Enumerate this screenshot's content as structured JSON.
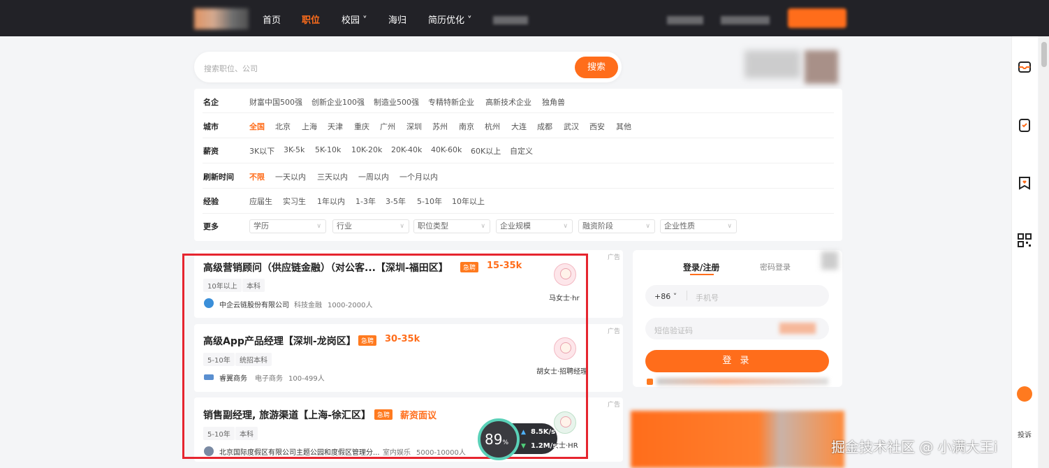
{
  "nav": {
    "items": [
      "首页",
      "职位",
      "校园 ˅",
      "海归",
      "简历优化 ˅"
    ],
    "active_index": 1
  },
  "search": {
    "placeholder": "搜索职位、公司",
    "button": "搜索"
  },
  "filters": {
    "famous": {
      "label": "名企",
      "options": [
        "财富中国500强",
        "创新企业100强",
        "制造业500强",
        "专精特新企业",
        "高新技术企业",
        "独角兽"
      ]
    },
    "city": {
      "label": "城市",
      "options": [
        "全国",
        "北京",
        "上海",
        "天津",
        "重庆",
        "广州",
        "深圳",
        "苏州",
        "南京",
        "杭州",
        "大连",
        "成都",
        "武汉",
        "西安",
        "其他"
      ],
      "selected": "全国"
    },
    "salary": {
      "label": "薪资",
      "options": [
        "3K以下",
        "3K-5k",
        "5K-10k",
        "10K-20k",
        "20K-40k",
        "40K-60k",
        "60K以上",
        "自定义"
      ]
    },
    "refresh": {
      "label": "刷新时间",
      "options": [
        "不限",
        "一天以内",
        "三天以内",
        "一周以内",
        "一个月以内"
      ],
      "selected": "不限"
    },
    "experience": {
      "label": "经验",
      "options": [
        "应届生",
        "实习生",
        "1年以内",
        "1-3年",
        "3-5年",
        "5-10年",
        "10年以上"
      ]
    },
    "more": {
      "label": "更多",
      "dropdowns": [
        "学历",
        "行业",
        "职位类型",
        "企业规模",
        "融资阶段",
        "企业性质"
      ]
    }
  },
  "jobs": [
    {
      "title": "高级营销顾问（供应链金融）（对公客...【深圳-福田区】",
      "urgent": "急聘",
      "salary": "15-35k",
      "tags": [
        "10年以上",
        "本科"
      ],
      "company": "中企云链股份有限公司",
      "industry": "科技金融",
      "size": "1000-2000人",
      "hr": "马女士·hr",
      "ad": "广告"
    },
    {
      "title": "高级App产品经理【深圳-龙岗区】",
      "urgent": "急聘",
      "salary": "30-35k",
      "tags": [
        "5-10年",
        "统招本科"
      ],
      "company": "睿翼商务",
      "industry": "电子商务",
      "size": "100-499人",
      "hr": "胡女士·招聘经理",
      "ad": "广告"
    },
    {
      "title": "销售副经理, 旅游渠道【上海-徐汇区】",
      "urgent": "急聘",
      "salary": "薪资面议",
      "tags": [
        "5-10年",
        "本科"
      ],
      "company": "北京国际度假区有限公司主题公园和度假区管理分...",
      "industry": "室内娱乐",
      "size": "5000-10000人",
      "hr": "女士·HR",
      "ad": "广告"
    }
  ],
  "login": {
    "tab_active": "登录/注册",
    "tab_inactive": "密码登录",
    "country_code": "+86 ˅",
    "phone_placeholder": "手机号",
    "code_placeholder": "短信验证码",
    "button": "登 录"
  },
  "rail": {
    "feedback_label": "投诉"
  },
  "speed": {
    "percent": "89",
    "percent_unit": "%",
    "up": "8.5K/s",
    "down": "1.2M/s"
  },
  "watermark": "掘金技术社区 @ 小满大王i",
  "colors": {
    "accent": "#ff6d1b",
    "nav_bg": "#222227",
    "highlight": "#e6252f"
  }
}
